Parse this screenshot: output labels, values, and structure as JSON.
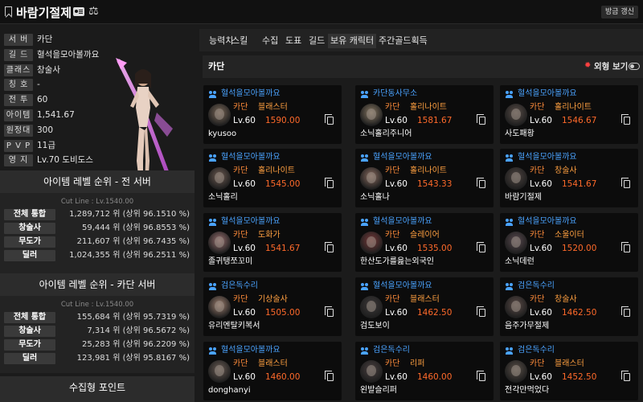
{
  "header": {
    "title": "바람기절제",
    "update_label": "방금 갱신"
  },
  "profile": {
    "rows": [
      {
        "label": "서 버",
        "value": "카단"
      },
      {
        "label": "길 드",
        "value": "혈석을모아볼까요"
      },
      {
        "label": "클래스",
        "value": "창술사"
      },
      {
        "label": "칭 호",
        "value": "-"
      },
      {
        "label": "전 투",
        "value": "60"
      },
      {
        "label": "아이템",
        "value": "1,541.67"
      },
      {
        "label": "원정대",
        "value": "300"
      },
      {
        "label": "P V P",
        "value": "11급"
      },
      {
        "label": "영 지",
        "value": "Lv.70 도비도스"
      }
    ]
  },
  "rank_all": {
    "title": "아이템 레벨 순위 - 전 서버",
    "cutline": "Cut Line : Lv.1540.00",
    "rows": [
      {
        "label": "전체 통합",
        "value": "1,289,712 위 (상위  96.1510 %)"
      },
      {
        "label": "창술사",
        "value": "59,444 위 (상위  96.8553 %)"
      },
      {
        "label": "무도가",
        "value": "211,607 위 (상위  96.7435 %)"
      },
      {
        "label": "딜러",
        "value": "1,024,355 위 (상위  96.2511 %)"
      }
    ]
  },
  "rank_server": {
    "title": "아이템 레벨 순위 - 카단 서버",
    "cutline": "Cut Line : Lv.1540.00",
    "rows": [
      {
        "label": "전체 통합",
        "value": "155,684 위 (상위  95.7319 %)"
      },
      {
        "label": "창술사",
        "value": "7,314 위 (상위  96.5672 %)"
      },
      {
        "label": "무도가",
        "value": "25,283 위 (상위  96.2209 %)"
      },
      {
        "label": "딜러",
        "value": "123,981 위 (상위  95.8167 %)"
      }
    ]
  },
  "collect_title": "수집형 포인트",
  "tabs": [
    "능력치",
    "스킬",
    "수집",
    "도표",
    "길드",
    "보유 캐릭터",
    "주간골드획득"
  ],
  "active_tab": "보유 캐릭터",
  "server_bar": {
    "server": "카단",
    "look_label": "외형 보기"
  },
  "characters": [
    {
      "guild": "혈석을모아볼까요",
      "server": "카단",
      "class": "블래스터",
      "level": "Lv.60",
      "item_level": "1590.00",
      "name": "kyusoo"
    },
    {
      "guild": "카단동사무소",
      "server": "카단",
      "class": "홀리나이트",
      "level": "Lv.60",
      "item_level": "1581.67",
      "name": "소닉홀리주니어"
    },
    {
      "guild": "혈석을모아볼까요",
      "server": "카단",
      "class": "홀리나이트",
      "level": "Lv.60",
      "item_level": "1546.67",
      "name": "사도패황"
    },
    {
      "guild": "혈석을모아볼까요",
      "server": "카단",
      "class": "홀리나이트",
      "level": "Lv.60",
      "item_level": "1545.00",
      "name": "소닉홀리"
    },
    {
      "guild": "혈석을모아볼까요",
      "server": "카단",
      "class": "홀리나이트",
      "level": "Lv.60",
      "item_level": "1543.33",
      "name": "소닉홀나"
    },
    {
      "guild": "혈석을모아볼까요",
      "server": "카단",
      "class": "창술사",
      "level": "Lv.60",
      "item_level": "1541.67",
      "name": "바람기절제"
    },
    {
      "guild": "혈석을모아볼까요",
      "server": "카단",
      "class": "도화가",
      "level": "Lv.60",
      "item_level": "1541.67",
      "name": "졸귀탱쪼꼬미"
    },
    {
      "guild": "혈석을모아볼까요",
      "server": "카단",
      "class": "슬레이어",
      "level": "Lv.60",
      "item_level": "1535.00",
      "name": "한산도가를읊는외국인"
    },
    {
      "guild": "혈석을모아볼까요",
      "server": "카단",
      "class": "소울이터",
      "level": "Lv.60",
      "item_level": "1520.00",
      "name": "소닉데런"
    },
    {
      "guild": "검은독수리",
      "server": "카단",
      "class": "기상술사",
      "level": "Lv.60",
      "item_level": "1505.00",
      "name": "유리멘탈키복서"
    },
    {
      "guild": "혈석을모아볼까요",
      "server": "카단",
      "class": "블래스터",
      "level": "Lv.60",
      "item_level": "1462.50",
      "name": "검도보이"
    },
    {
      "guild": "검은독수리",
      "server": "카단",
      "class": "창술사",
      "level": "Lv.60",
      "item_level": "1462.50",
      "name": "음주가무절제"
    },
    {
      "guild": "혈석을모아볼까요",
      "server": "카단",
      "class": "블래스터",
      "level": "Lv.60",
      "item_level": "1460.00",
      "name": "donghanyi"
    },
    {
      "guild": "검은독수리",
      "server": "카단",
      "class": "리퍼",
      "level": "Lv.60",
      "item_level": "1460.00",
      "name": "왼발슬리퍼"
    },
    {
      "guild": "검은독수리",
      "server": "카단",
      "class": "블래스터",
      "level": "Lv.60",
      "item_level": "1452.50",
      "name": "전각만먹었다"
    }
  ]
}
